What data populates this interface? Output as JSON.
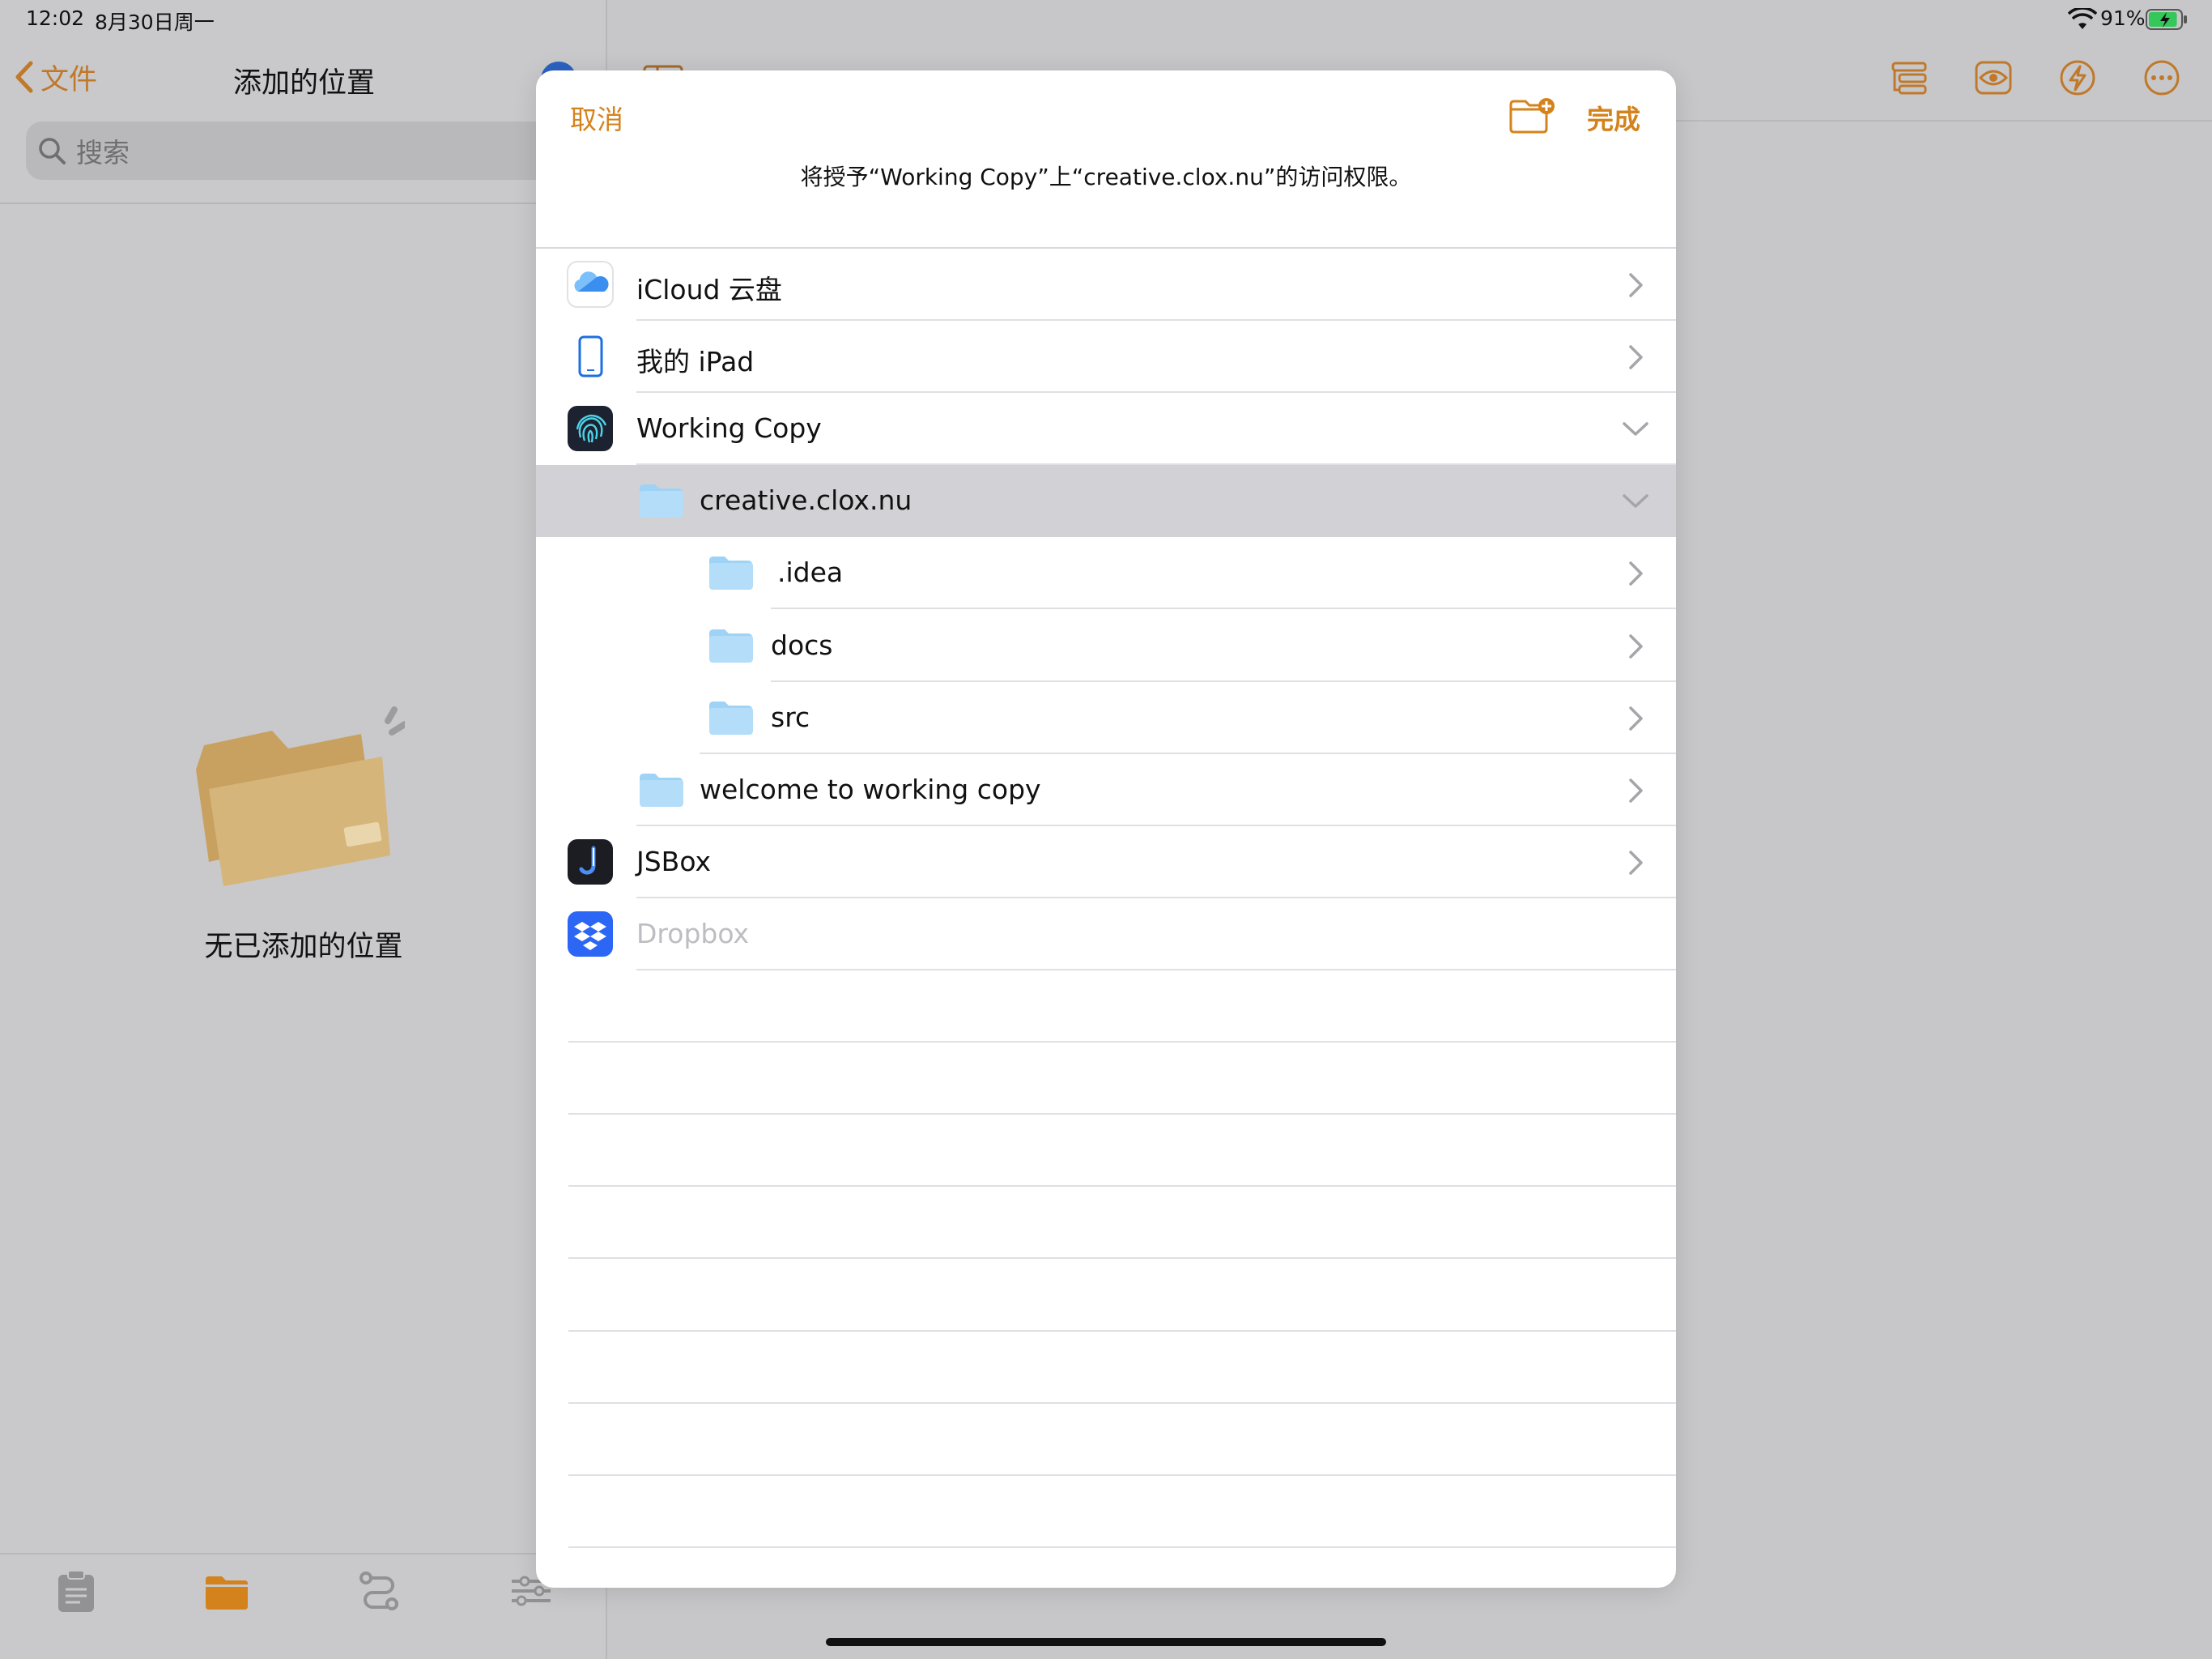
{
  "status_bar": {
    "time": "12:02",
    "date": "8月30日周一",
    "battery_percent": "91%",
    "battery_level": 0.91
  },
  "sidebar": {
    "back_label": "文件",
    "title": "添加的位置",
    "search_placeholder": "搜索",
    "empty_text": "无已添加的位置"
  },
  "tabs": [
    {
      "icon": "clipboard-icon"
    },
    {
      "icon": "folder-icon",
      "active": true
    },
    {
      "icon": "branch-icon"
    },
    {
      "icon": "settings-sliders-icon"
    }
  ],
  "toolbar": {
    "icons": [
      "outline-list-icon",
      "eye-icon",
      "lightning-icon",
      "more-icon"
    ]
  },
  "modal": {
    "cancel_label": "取消",
    "done_label": "完成",
    "prompt": "将授予“Working Copy”上“creative.clox.nu”的访问权限。",
    "items": [
      {
        "label": "iCloud 云盘",
        "icon": "icloud-icon",
        "level": 0,
        "chevron": "right",
        "enabled": true
      },
      {
        "label": "我的 iPad",
        "icon": "ipad-icon",
        "level": 0,
        "chevron": "right",
        "enabled": true
      },
      {
        "label": "Working Copy",
        "icon": "working-copy-app-icon",
        "level": 0,
        "chevron": "down",
        "enabled": true
      },
      {
        "label": "creative.clox.nu",
        "icon": "folder-icon",
        "level": 1,
        "chevron": "down",
        "enabled": true,
        "selected": true
      },
      {
        "label": ".idea",
        "icon": "folder-icon",
        "level": 2,
        "chevron": "right",
        "enabled": true
      },
      {
        "label": "docs",
        "icon": "folder-icon",
        "level": 2,
        "chevron": "right",
        "enabled": true
      },
      {
        "label": "src",
        "icon": "folder-icon",
        "level": 2,
        "chevron": "right",
        "enabled": true
      },
      {
        "label": "welcome to working copy",
        "icon": "folder-icon",
        "level": 1,
        "chevron": "right",
        "enabled": true
      },
      {
        "label": "JSBox",
        "icon": "jsbox-app-icon",
        "level": 0,
        "chevron": "right",
        "enabled": true
      },
      {
        "label": "Dropbox",
        "icon": "dropbox-app-icon",
        "level": 0,
        "chevron": "none",
        "enabled": false
      }
    ]
  },
  "colors": {
    "accent": "#d4831c",
    "background": "#c7c7c9",
    "modal_background": "#ffffff",
    "selected_row": "#d1d1d6",
    "folder_blue": "#9fd3f6"
  }
}
